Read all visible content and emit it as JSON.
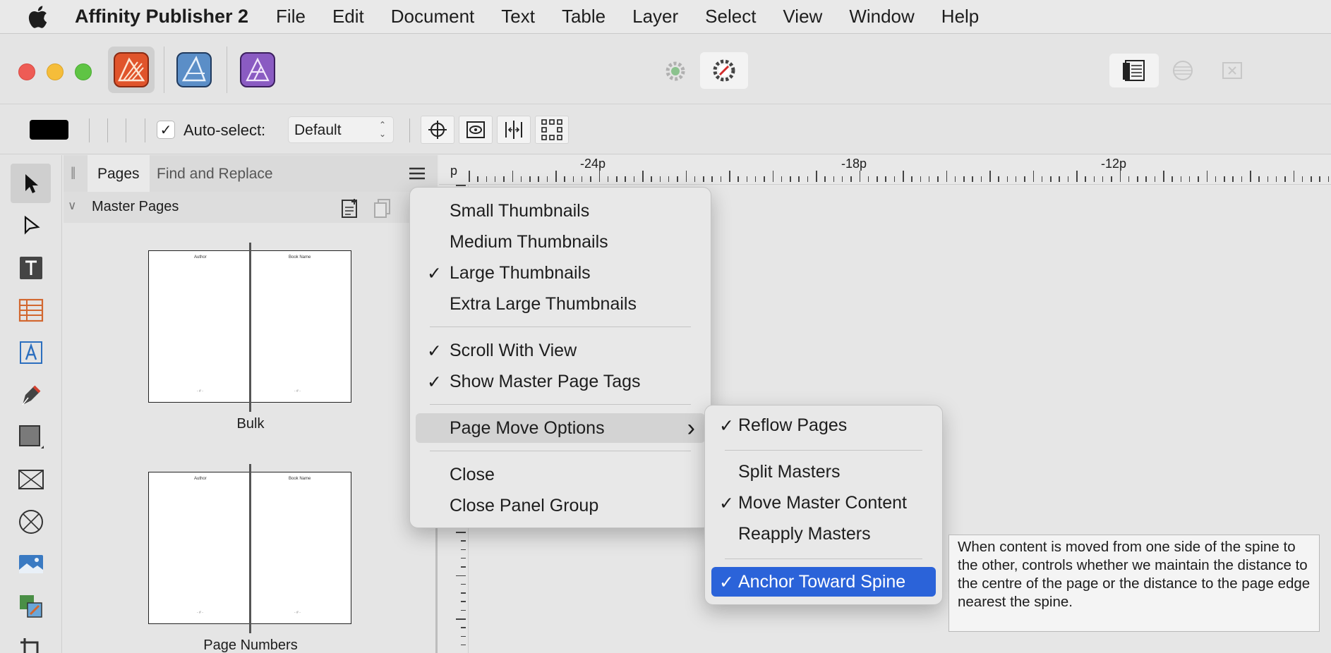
{
  "menubar": {
    "app_name": "Affinity Publisher 2",
    "items": [
      "File",
      "Edit",
      "Document",
      "Text",
      "Table",
      "Layer",
      "Select",
      "View",
      "Window",
      "Help"
    ]
  },
  "toolbar": {
    "autoselect_label": "Auto-select:",
    "autoselect_value": "Default"
  },
  "panel": {
    "tabs": [
      "Pages",
      "Find and Replace"
    ],
    "section": "Master Pages",
    "masters": [
      {
        "name": "Bulk",
        "left_header": "Author",
        "right_header": "Book Name"
      },
      {
        "name": "Page Numbers",
        "left_header": "Author",
        "right_header": "Book Name"
      }
    ]
  },
  "ruler": {
    "unit": "p",
    "labels": [
      "-24p",
      "-18p",
      "-12p"
    ]
  },
  "context_menu": {
    "items": [
      {
        "label": "Small Thumbnails",
        "checked": false
      },
      {
        "label": "Medium Thumbnails",
        "checked": false
      },
      {
        "label": "Large Thumbnails",
        "checked": true
      },
      {
        "label": "Extra Large Thumbnails",
        "checked": false
      },
      {
        "label": "Scroll With View",
        "checked": true
      },
      {
        "label": "Show Master Page Tags",
        "checked": true
      },
      {
        "label": "Page Move Options",
        "checked": false,
        "submenu": true
      },
      {
        "label": "Close",
        "checked": false
      },
      {
        "label": "Close Panel Group",
        "checked": false
      }
    ]
  },
  "submenu": {
    "items": [
      {
        "label": "Reflow Pages",
        "checked": true
      },
      {
        "label": "Split Masters",
        "checked": false
      },
      {
        "label": "Move Master Content",
        "checked": true
      },
      {
        "label": "Reapply Masters",
        "checked": false
      },
      {
        "label": "Anchor Toward Spine",
        "checked": true,
        "selected": true
      }
    ]
  },
  "tooltip": {
    "text": "When content is moved from one side of the spine to the other, controls whether we maintain the distance to the centre of the page or the distance to the page edge nearest the spine."
  },
  "glyphs": {
    "check": "✓",
    "submenu_arrow": "›",
    "chevron": "∨",
    "handle": "||"
  },
  "colors": {
    "selection": "#2b63d9",
    "publisher_icon": "#e0542b",
    "designer_icon": "#5b8ec7",
    "photo_icon": "#8a5bc2",
    "close": "#ee5c55",
    "minimize": "#f5bd3a",
    "maximize": "#5fc444"
  }
}
